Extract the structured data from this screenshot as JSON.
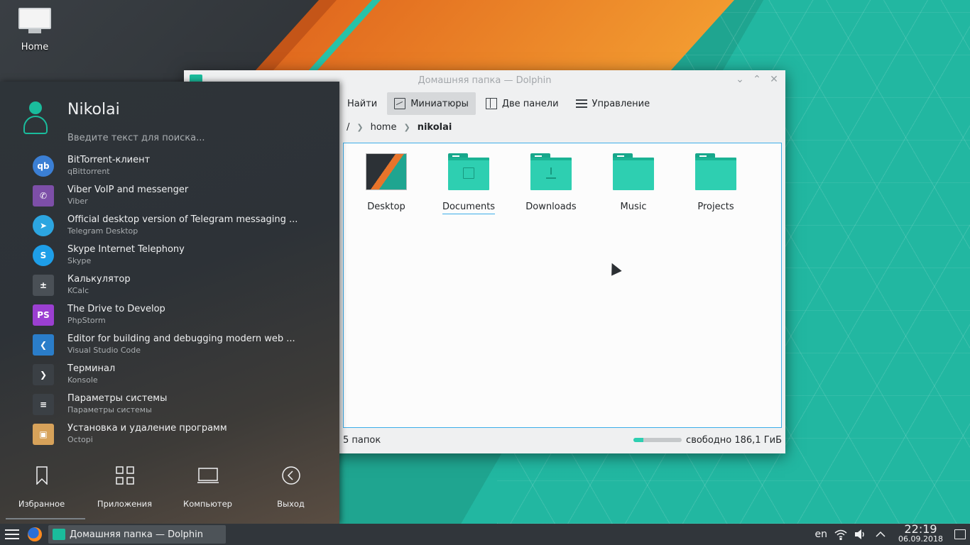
{
  "desktop": {
    "home_icon_label": "Home"
  },
  "window": {
    "title": "Домашняя папка — Dolphin",
    "toolbar": {
      "search_label": "Найти",
      "thumbnails_label": "Миниатюры",
      "split_label": "Две панели",
      "control_label": "Управление"
    },
    "breadcrumb": {
      "root": "/",
      "home": "home",
      "current": "nikolai"
    },
    "items": [
      {
        "name": "Desktop",
        "icon": "wallpaper-thumbnail"
      },
      {
        "name": "Documents",
        "icon": "folder-documents-icon"
      },
      {
        "name": "Downloads",
        "icon": "folder-downloads-icon"
      },
      {
        "name": "Music",
        "icon": "folder-icon"
      },
      {
        "name": "Projects",
        "icon": "folder-icon"
      }
    ],
    "status": {
      "count": "5 папок",
      "free_space": "свободно 186,1 ГиБ",
      "used_fraction": 0.2
    }
  },
  "launcher": {
    "username": "Nikolai",
    "search_placeholder": "Введите текст для поиска...",
    "apps": [
      {
        "name": "BitTorrent-клиент",
        "desc": "qBittorrent",
        "icon": "qbittorrent-icon",
        "color": "#3b7fd4"
      },
      {
        "name": "Viber VoIP and messenger",
        "desc": "Viber",
        "icon": "viber-icon",
        "color": "#7d4fa8"
      },
      {
        "name": "Official desktop version of Telegram messaging ...",
        "desc": "Telegram Desktop",
        "icon": "telegram-icon",
        "color": "#2ca5e0"
      },
      {
        "name": "Skype Internet Telephony",
        "desc": "Skype",
        "icon": "skype-icon",
        "color": "#1e9ee8"
      },
      {
        "name": "Калькулятор",
        "desc": "KCalc",
        "icon": "calculator-icon",
        "color": "#4a5056"
      },
      {
        "name": "The Drive to Develop",
        "desc": "PhpStorm",
        "icon": "phpstorm-icon",
        "color": "#9b3fd1"
      },
      {
        "name": "Editor for building and debugging modern web ...",
        "desc": "Visual Studio Code",
        "icon": "vscode-icon",
        "color": "#2a7dc9"
      },
      {
        "name": "Терминал",
        "desc": "Konsole",
        "icon": "terminal-icon",
        "color": "#3b4045"
      },
      {
        "name": "Параметры системы",
        "desc": "Параметры системы",
        "icon": "settings-icon",
        "color": "#3b4045"
      },
      {
        "name": "Установка и удаление программ",
        "desc": "Octopi",
        "icon": "package-icon",
        "color": "#d7a25a"
      }
    ],
    "nav": {
      "favorites": "Избранное",
      "applications": "Приложения",
      "computer": "Компьютер",
      "leave": "Выход"
    }
  },
  "taskbar": {
    "task_label": "Домашняя папка — Dolphin",
    "lang": "en",
    "time": "22:19",
    "date": "06.09.2018"
  }
}
